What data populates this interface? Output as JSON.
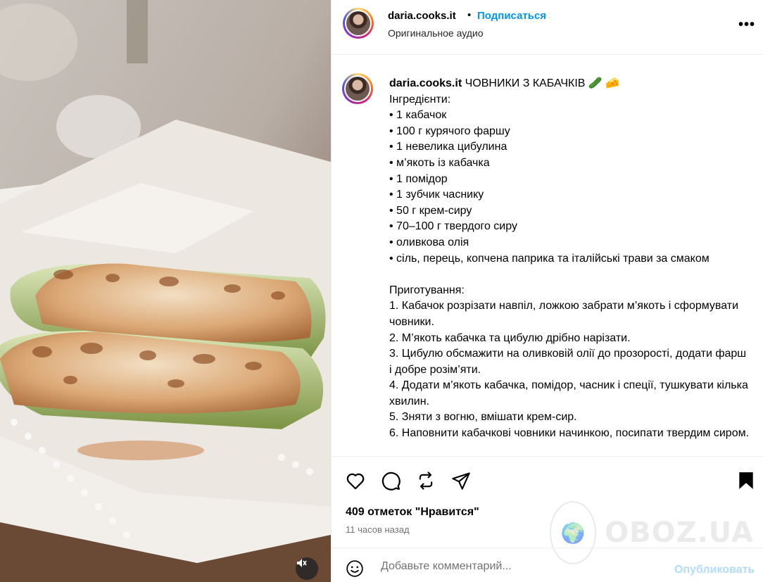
{
  "header": {
    "username": "daria.cooks.it",
    "separator": "•",
    "follow_label": "Подписаться",
    "audio_label": "Оригинальное аудио",
    "more_label": "•••"
  },
  "caption": {
    "username": "daria.cooks.it",
    "text": " ЧОВНИКИ З КАБАЧКІВ 🥒 🧀\nІнгредієнти:\n• 1 кабачок\n• 100 г курячого фаршу\n• 1 невелика цибулина\n• м’якоть із кабачка\n• 1 помідор\n• 1 зубчик часнику\n• 50 г крем-сиру\n• 70–100 г твердого сиру\n• оливкова олія\n• сіль, перець, копчена паприка та італійські трави за смаком\n\nПриготування:\n1. Кабачок розрізати навпіл, ложкою забрати м’якоть і сформувати човники.\n2. М’якоть кабачка та цибулю дрібно нарізати.\n3. Цибулю обсмажити на оливковій олії до прозорості, додати фарш і добре розім’яти.\n4. Додати м’якоть кабачка, помідор, часник і спеції, тушкувати кілька хвилин.\n5. Зняти з вогню, вмішати крем-сир.\n6. Наповнити кабачкові човники начинкою, посипати твердим сиром."
  },
  "actions": {
    "like_icon": "heart-icon",
    "comment_icon": "comment-icon",
    "repost_icon": "repost-icon",
    "share_icon": "send-icon",
    "save_icon": "bookmark-icon"
  },
  "likes_text": "409 отметок \"Нравится\"",
  "time_text": "11 часов назад",
  "comment": {
    "placeholder": "Добавьте комментарий...",
    "post_label": "Опубликовать"
  },
  "watermark": {
    "text": "OBOZ.UA"
  },
  "colors": {
    "accent": "#0095f6",
    "post_disabled": "#b3dbff",
    "muted_text": "#737373"
  }
}
